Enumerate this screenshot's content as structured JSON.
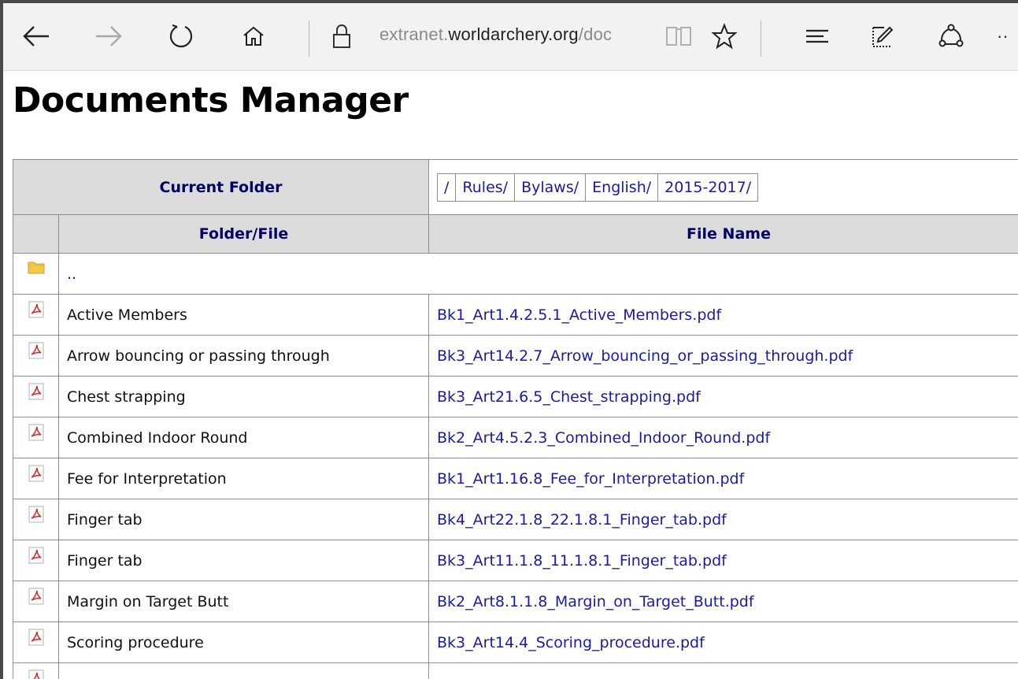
{
  "browser": {
    "address_prefix": "extranet.",
    "address_domain": "worldarchery.org",
    "address_suffix": "/doc",
    "more_label": "··"
  },
  "page": {
    "title": "Documents Manager"
  },
  "table": {
    "current_folder_label": "Current Folder",
    "breadcrumbs": [
      "/",
      "Rules/",
      "Bylaws/",
      "English/",
      "2015-2017/"
    ],
    "col_folder_file": "Folder/File",
    "col_file_name": "File Name",
    "parent_link": "..",
    "rows": [
      {
        "name": "Active Members",
        "file": "Bk1_Art1.4.2.5.1_Active_Members.pdf"
      },
      {
        "name": "Arrow bouncing or passing through",
        "file": "Bk3_Art14.2.7_Arrow_bouncing_or_passing_through.pdf"
      },
      {
        "name": "Chest strapping",
        "file": "Bk3_Art21.6.5_Chest_strapping.pdf"
      },
      {
        "name": "Combined Indoor Round",
        "file": "Bk2_Art4.5.2.3_Combined_Indoor_Round.pdf"
      },
      {
        "name": "Fee for Interpretation",
        "file": "Bk1_Art1.16.8_Fee_for_Interpretation.pdf"
      },
      {
        "name": "Finger tab",
        "file": "Bk4_Art22.1.8_22.1.8.1_Finger_tab.pdf"
      },
      {
        "name": "Finger tab",
        "file": "Bk3_Art11.1.8_11.1.8.1_Finger_tab.pdf"
      },
      {
        "name": "Margin on Target Butt",
        "file": "Bk2_Art8.1.1.8_Margin_on_Target_Butt.pdf"
      },
      {
        "name": "Scoring procedure",
        "file": "Bk3_Art14.4_Scoring_procedure.pdf"
      },
      {
        "name": "",
        "file": ""
      }
    ]
  },
  "colors": {
    "link": "#1a1aa6",
    "header_text": "#000066",
    "header_bg": "#dcdcdc"
  }
}
